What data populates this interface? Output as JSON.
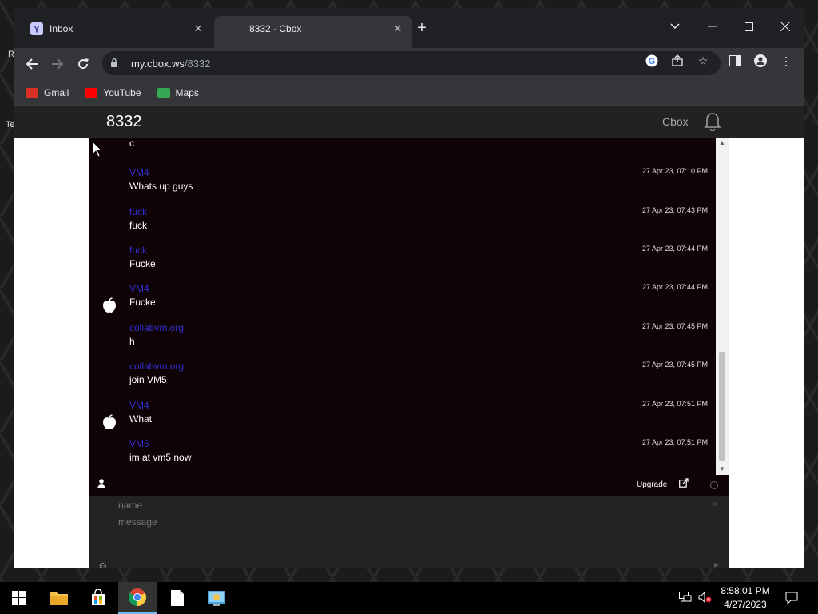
{
  "desktop": {
    "fragment_r": "R",
    "fragment_te": "Te"
  },
  "browser": {
    "tabs": [
      {
        "title": "Inbox",
        "favicon": "yahoo-mail-icon",
        "active": false
      },
      {
        "title": "8332 · Cbox",
        "favicon": "",
        "active": true
      }
    ],
    "url_host": "my.cbox.ws",
    "url_path": "/8332",
    "bookmarks": [
      {
        "label": "Gmail",
        "icon": "gmail-icon",
        "color": "#d93025"
      },
      {
        "label": "YouTube",
        "icon": "youtube-icon",
        "color": "#ff0000"
      },
      {
        "label": "Maps",
        "icon": "maps-icon",
        "color": "#34a853"
      }
    ]
  },
  "page": {
    "room_title": "8332",
    "brand_link": "Cbox"
  },
  "chat": {
    "partial_message": {
      "text": "c"
    },
    "messages": [
      {
        "name": "VM4",
        "time": "27 Apr 23, 07:10 PM",
        "text": "Whats up guys",
        "avatar": ""
      },
      {
        "name": "fuck",
        "time": "27 Apr 23, 07:43 PM",
        "text": "fuck",
        "avatar": ""
      },
      {
        "name": "fuck",
        "time": "27 Apr 23, 07:44 PM",
        "text": "Fucke",
        "avatar": ""
      },
      {
        "name": "VM4",
        "time": "27 Apr 23, 07:44 PM",
        "text": "Fucke",
        "avatar": "apple-icon"
      },
      {
        "name": "collabvm.org",
        "time": "27 Apr 23, 07:45 PM",
        "text": "h",
        "avatar": ""
      },
      {
        "name": "collabvm.org",
        "time": "27 Apr 23, 07:45 PM",
        "text": "join VM5",
        "avatar": ""
      },
      {
        "name": "VM4",
        "time": "27 Apr 23, 07:51 PM",
        "text": "What",
        "avatar": "apple-icon"
      },
      {
        "name": "VM5",
        "time": "27 Apr 23, 07:51 PM",
        "text": "im at vm5 now",
        "avatar": ""
      }
    ],
    "upgrade_label": "Upgrade",
    "name_placeholder": "name",
    "message_placeholder": "message"
  },
  "taskbar": {
    "time": "8:58:01 PM",
    "date": "4/27/2023"
  }
}
